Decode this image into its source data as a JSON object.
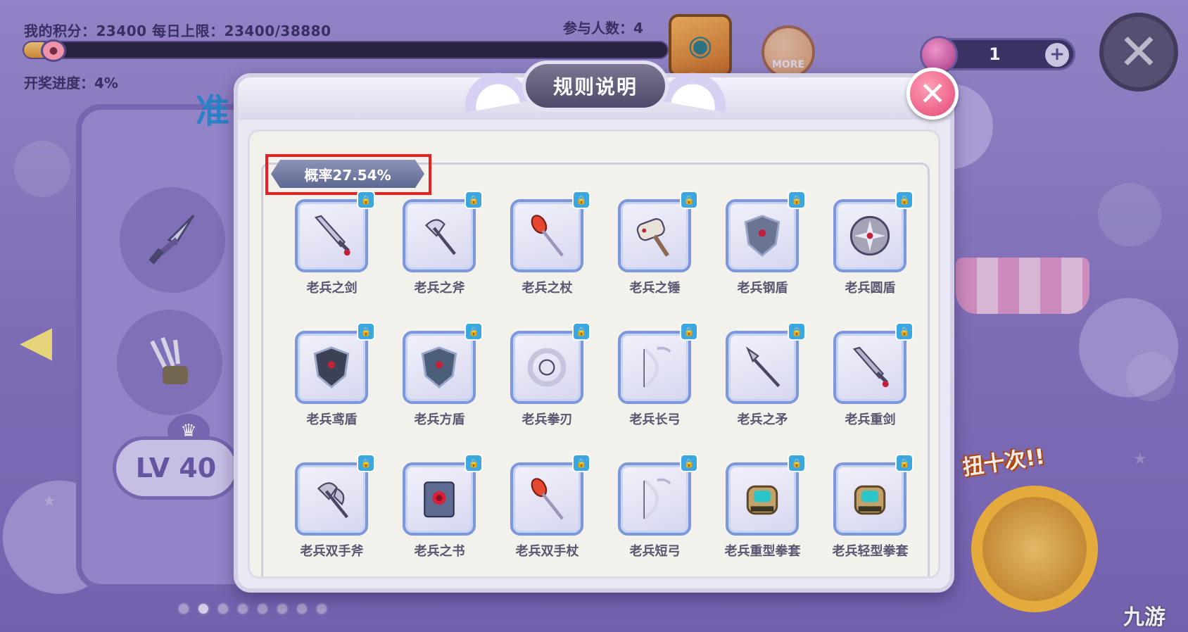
{
  "hud": {
    "score_text": "我的积分：23400 每日上限：23400/38880",
    "participants": "参与人数：4",
    "lottery_progress": "开奖进度：4%",
    "lottery_progress_value": 0.04,
    "more_label": "MORE",
    "currency_value": "1",
    "currency_add": "+"
  },
  "background": {
    "left_title": "准",
    "level": "LV 40",
    "ten_spin_label": "扭十次!!",
    "page_dots_count": 8,
    "page_dots_active": 1,
    "watermark": "九游"
  },
  "modal": {
    "title": "规则说明",
    "close_label": "✕",
    "rate_tag": "概率27.54%",
    "items": [
      {
        "name": "老兵之剑",
        "icon": "sword-icon",
        "color": "#c9c3de"
      },
      {
        "name": "老兵之斧",
        "icon": "axe-icon",
        "color": "#d8d3ea"
      },
      {
        "name": "老兵之杖",
        "icon": "staff-icon",
        "color": "#e6452f"
      },
      {
        "name": "老兵之锤",
        "icon": "hammer-icon",
        "color": "#e8e2d9"
      },
      {
        "name": "老兵钢盾",
        "icon": "steel-shield-icon",
        "color": "#6b7593"
      },
      {
        "name": "老兵圆盾",
        "icon": "round-shield-icon",
        "color": "#a4a3b8"
      },
      {
        "name": "老兵鸢盾",
        "icon": "kite-shield-icon",
        "color": "#3c4156"
      },
      {
        "name": "老兵方盾",
        "icon": "square-shield-icon",
        "color": "#4d5e7b"
      },
      {
        "name": "老兵拳刃",
        "icon": "fist-blade-icon",
        "color": "#c7c5de"
      },
      {
        "name": "老兵长弓",
        "icon": "longbow-icon",
        "color": "#d9d5ea"
      },
      {
        "name": "老兵之矛",
        "icon": "spear-icon",
        "color": "#bfbccf"
      },
      {
        "name": "老兵重剑",
        "icon": "greatsword-icon",
        "color": "#b6b3cc"
      },
      {
        "name": "老兵双手斧",
        "icon": "double-axe-icon",
        "color": "#c5c2d8"
      },
      {
        "name": "老兵之书",
        "icon": "book-icon",
        "color": "#5e6c93"
      },
      {
        "name": "老兵双手杖",
        "icon": "two-hand-staff-icon",
        "color": "#e64830"
      },
      {
        "name": "老兵短弓",
        "icon": "shortbow-icon",
        "color": "#d9d5ea"
      },
      {
        "name": "老兵重型拳套",
        "icon": "heavy-gauntlet-icon",
        "color": "#2ac5c9"
      },
      {
        "name": "老兵轻型拳套",
        "icon": "light-gauntlet-icon",
        "color": "#2ac5c9"
      }
    ]
  }
}
